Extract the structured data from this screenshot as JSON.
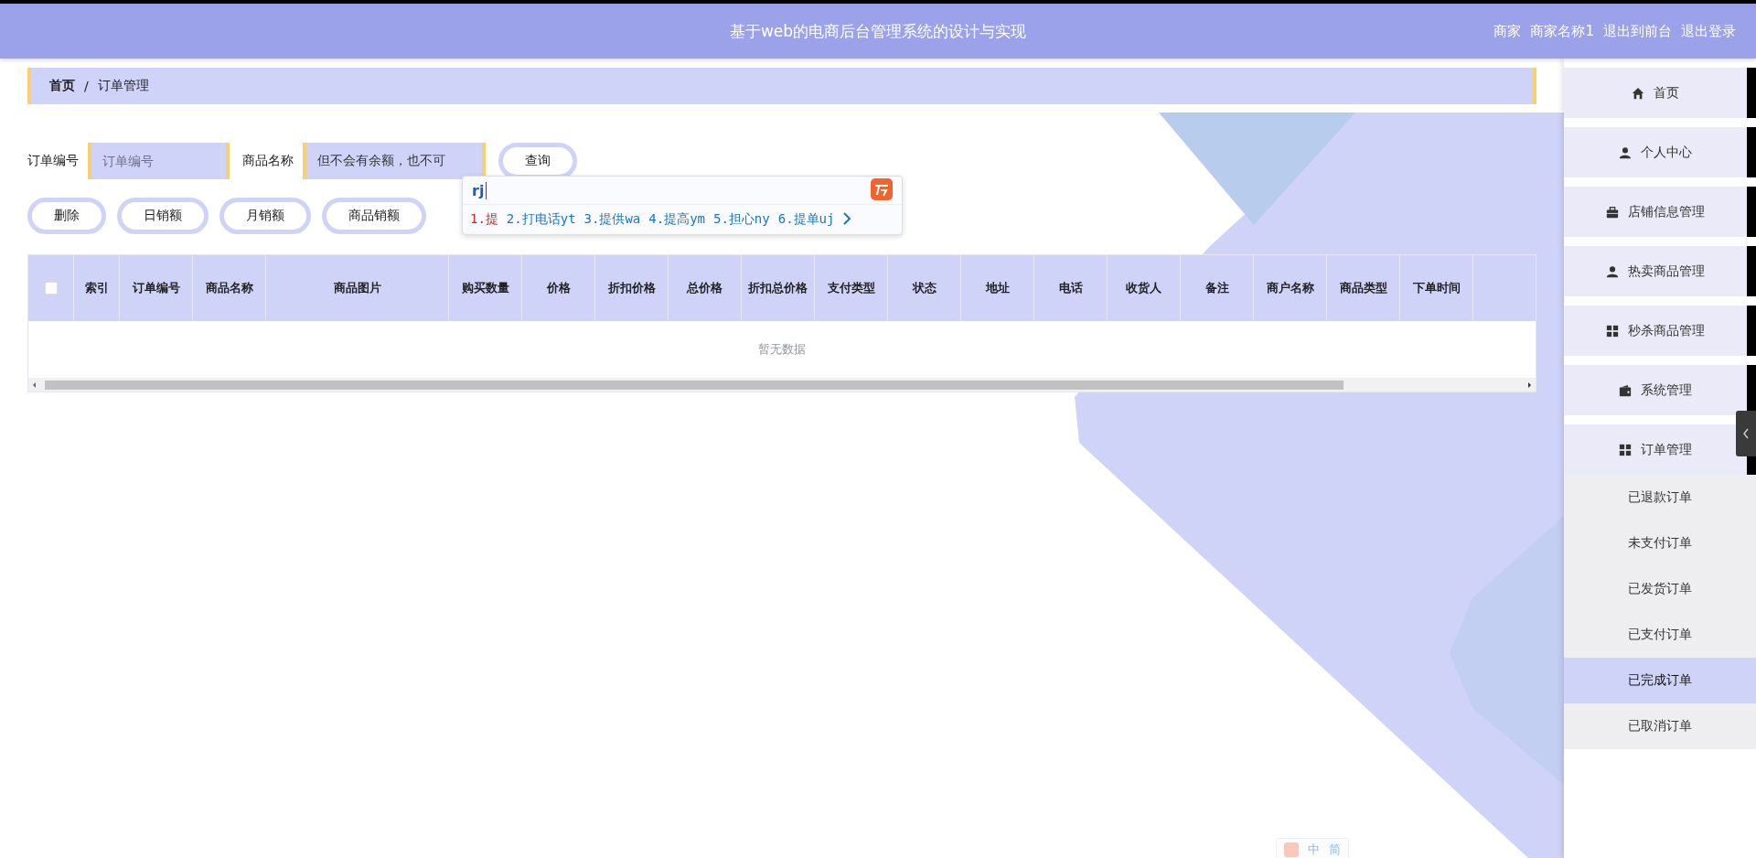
{
  "header": {
    "title": "基于web的电商后台管理系统的设计与实现",
    "user_role": "商家",
    "user_name": "商家名称1",
    "links": [
      "退出到前台",
      "退出登录"
    ]
  },
  "breadcrumb": {
    "items": [
      "首页",
      "订单管理"
    ],
    "separator": "/"
  },
  "filters": [
    {
      "label": "订单编号",
      "placeholder": "订单编号"
    },
    {
      "label": "商品名称",
      "value": "但不会有余额，也不可"
    }
  ],
  "search_button": "查询",
  "actions": [
    "删除",
    "日销额",
    "月销额",
    "商品销额"
  ],
  "ime_popup": {
    "input": "rj",
    "candidates": [
      {
        "text": "1.提",
        "selected": true
      },
      {
        "text": "2.打电话yt",
        "selected": false
      },
      {
        "text": "3.提供wa",
        "selected": false
      },
      {
        "text": "4.提高ym",
        "selected": false
      },
      {
        "text": "5.担心ny",
        "selected": false
      },
      {
        "text": "6.提单uj",
        "selected": false
      }
    ]
  },
  "table": {
    "select_all_checked": false,
    "columns": [
      "索引",
      "订单编号",
      "商品名称",
      "商品图片",
      "购买数量",
      "价格",
      "折扣价格",
      "总价格",
      "折扣总价格",
      "支付类型",
      "状态",
      "地址",
      "电话",
      "收货人",
      "备注",
      "商户名称",
      "商品类型",
      "下单时间"
    ],
    "empty_text": "暂无数据"
  },
  "sidebar": {
    "items": [
      {
        "label": "首页",
        "kind": "home"
      },
      {
        "label": "个人中心",
        "kind": "user"
      },
      {
        "label": "店铺信息管理",
        "kind": "briefcase"
      },
      {
        "label": "热卖商品管理",
        "kind": "user"
      },
      {
        "label": "秒杀商品管理",
        "kind": "grid"
      },
      {
        "label": "系统管理",
        "kind": "wallet"
      },
      {
        "label": "订单管理",
        "kind": "grid",
        "children": [
          {
            "label": "已退款订单",
            "selected": false
          },
          {
            "label": "未支付订单",
            "selected": false
          },
          {
            "label": "已发货订单",
            "selected": false
          },
          {
            "label": "已支付订单",
            "selected": false
          },
          {
            "label": "已完成订单",
            "selected": true
          },
          {
            "label": "已取消订单",
            "selected": false
          }
        ]
      }
    ]
  },
  "ime_status": [
    "中",
    "简"
  ]
}
